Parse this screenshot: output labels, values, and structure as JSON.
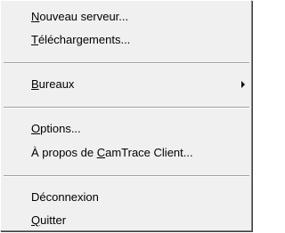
{
  "menu": {
    "items": [
      {
        "pre": "",
        "mnemonic": "N",
        "post": "ouveau serveur..."
      },
      {
        "pre": "",
        "mnemonic": "T",
        "post": "éléchargements..."
      },
      {
        "pre": "",
        "mnemonic": "B",
        "post": "ureaux",
        "submenu": true
      },
      {
        "pre": "",
        "mnemonic": "O",
        "post": "ptions..."
      },
      {
        "pre": "À propos de ",
        "mnemonic": "C",
        "post": "amTrace Client..."
      },
      {
        "pre": "Déconnexion",
        "mnemonic": "",
        "post": ""
      },
      {
        "pre": "",
        "mnemonic": "Q",
        "post": "uitter"
      }
    ]
  },
  "icons": {
    "submenu_arrow": "chevron-right-icon"
  },
  "colors": {
    "menu_background": "#f0f0f0",
    "separator": "#a0a0a0",
    "highlight": "#0a246a"
  }
}
